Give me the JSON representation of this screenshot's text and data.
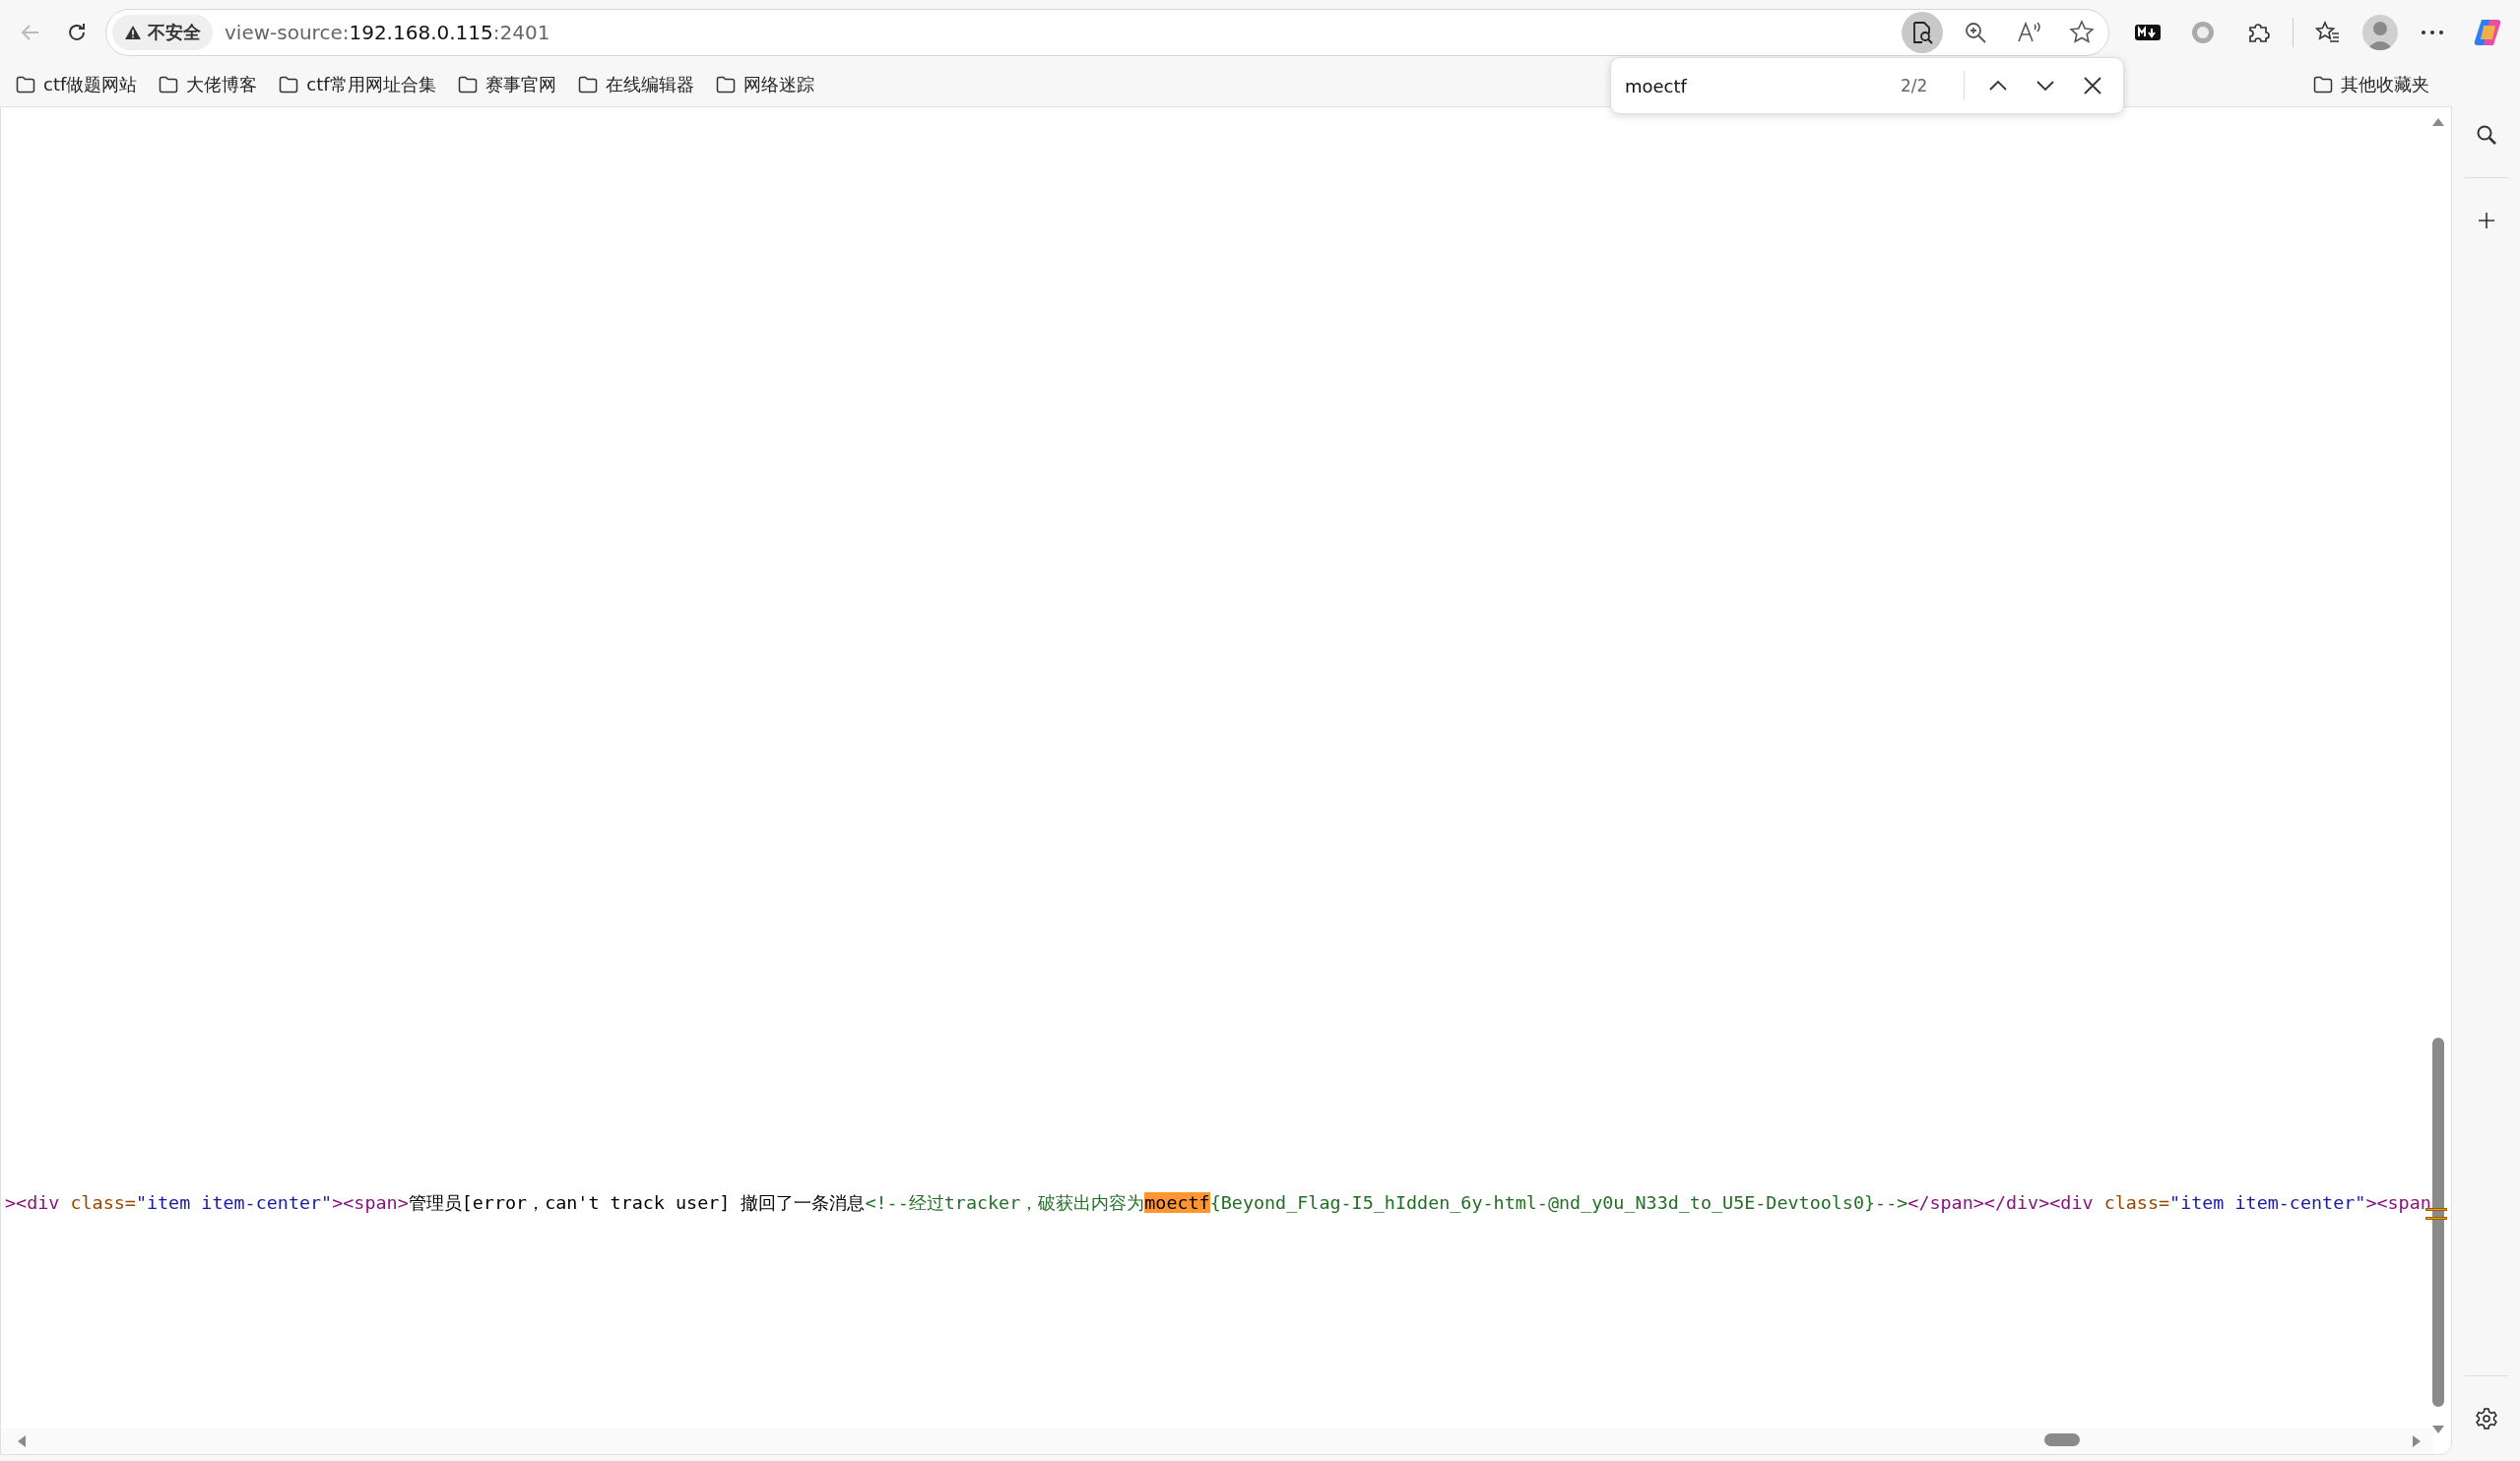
{
  "toolbar": {
    "security_label": "不安全",
    "url": {
      "scheme": "view-source:",
      "host": "192.168.0.115",
      "port": ":2401"
    }
  },
  "bookmarks": [
    {
      "label": "ctf做题网站"
    },
    {
      "label": "大佬博客"
    },
    {
      "label": "ctf常用网址合集"
    },
    {
      "label": "赛事官网"
    },
    {
      "label": "在线编辑器"
    },
    {
      "label": "网络迷踪"
    }
  ],
  "other_bookmarks": "其他收藏夹",
  "find_bar": {
    "value": "moectf",
    "count": "2/2"
  },
  "source_line": [
    {
      "kind": "tag",
      "text": ">"
    },
    {
      "kind": "tag",
      "text": "<div "
    },
    {
      "kind": "attr",
      "text": "class="
    },
    {
      "kind": "value",
      "text": "\"item item-center\""
    },
    {
      "kind": "tag",
      "text": ">"
    },
    {
      "kind": "tag",
      "text": "<span>"
    },
    {
      "kind": "text",
      "text": "管理员[error，can't track user] 撤回了一条消息"
    },
    {
      "kind": "comment",
      "text": "<!--经过tracker，破获出内容为"
    },
    {
      "kind": "match",
      "text": "moectf"
    },
    {
      "kind": "comment",
      "text": "{Beyond_Flag-I5_hIdden_6y-html-@nd_y0u_N33d_to_U5E-Devtools0}-->"
    },
    {
      "kind": "tag",
      "text": "</span>"
    },
    {
      "kind": "tag",
      "text": "</div>"
    },
    {
      "kind": "tag",
      "text": "<div "
    },
    {
      "kind": "attr",
      "text": "class="
    },
    {
      "kind": "value",
      "text": "\"item item-center\""
    },
    {
      "kind": "tag",
      "text": ">"
    },
    {
      "kind": "tag",
      "text": "<span"
    }
  ]
}
